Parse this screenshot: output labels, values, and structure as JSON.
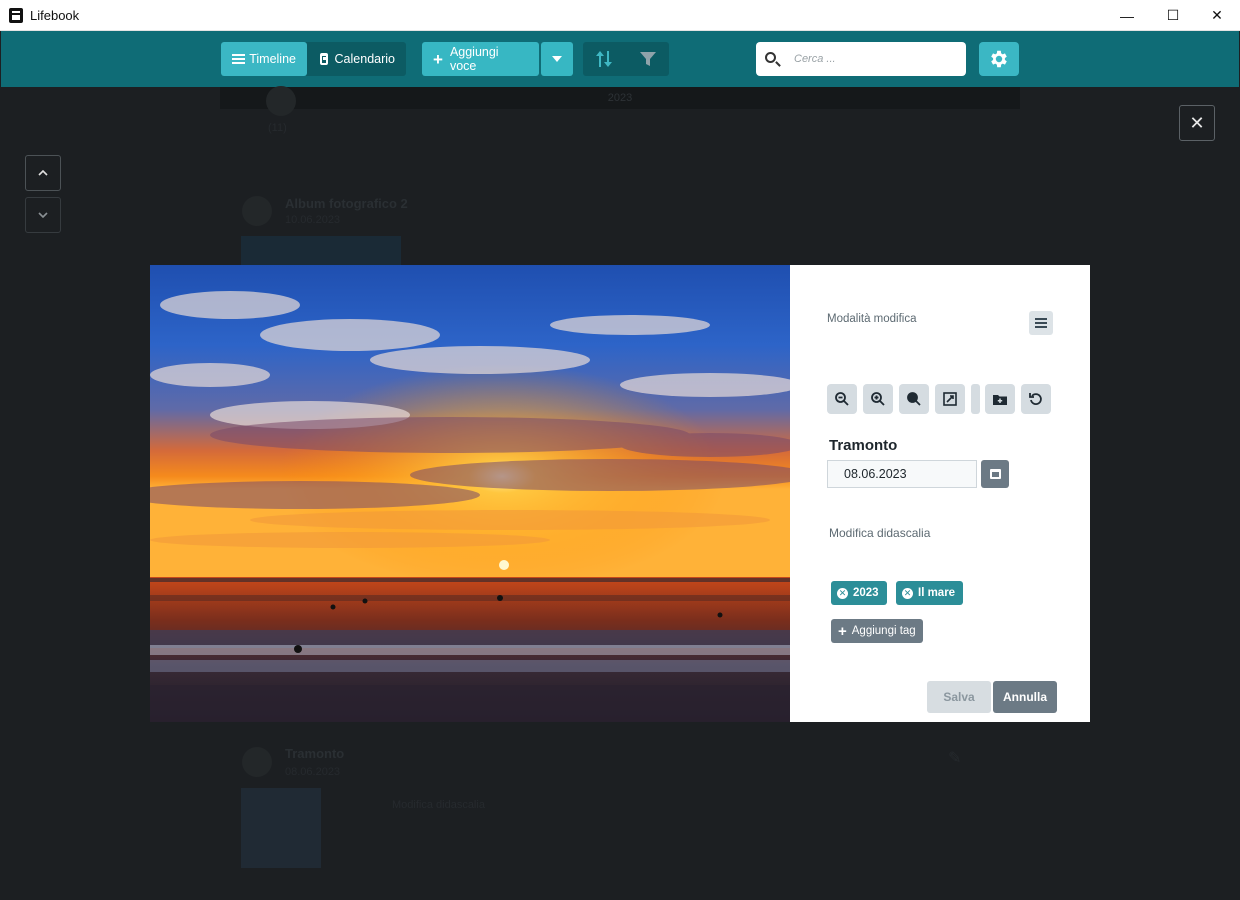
{
  "window": {
    "title": "Lifebook",
    "minimize": "—",
    "maximize": "☐",
    "close": "✕"
  },
  "toolbar": {
    "timeline_label": "Timeline",
    "calendar_label": "Calendario",
    "add_entry_label": "Aggiungi voce",
    "search_placeholder": "Cerca ...",
    "settings_icon": "gear-icon"
  },
  "background": {
    "year_bar": "2023",
    "entry1_title": "Album fotografico 2",
    "entry1_date": "10.06.2023",
    "entry2_title": "Tramonto",
    "entry2_date": "08.06.2023",
    "entry2_caption": "Modifica didascalia",
    "count": "(11)"
  },
  "viewer": {
    "close_icon": "✕",
    "prev_icon": "⌃",
    "next_icon": "⌄"
  },
  "panel": {
    "edit_mode_label": "Modalità modifica",
    "title": "Tramonto",
    "date": "08.06.2023",
    "caption_label": "Modifica didascalia",
    "tags": [
      "2023",
      "Il mare"
    ],
    "add_tag_label": "Aggiungi tag",
    "save_label": "Salva",
    "cancel_label": "Annulla"
  },
  "colors": {
    "toolbar": "#0f6c76",
    "accent": "#3bb7c4",
    "tag": "#2c8e98"
  }
}
